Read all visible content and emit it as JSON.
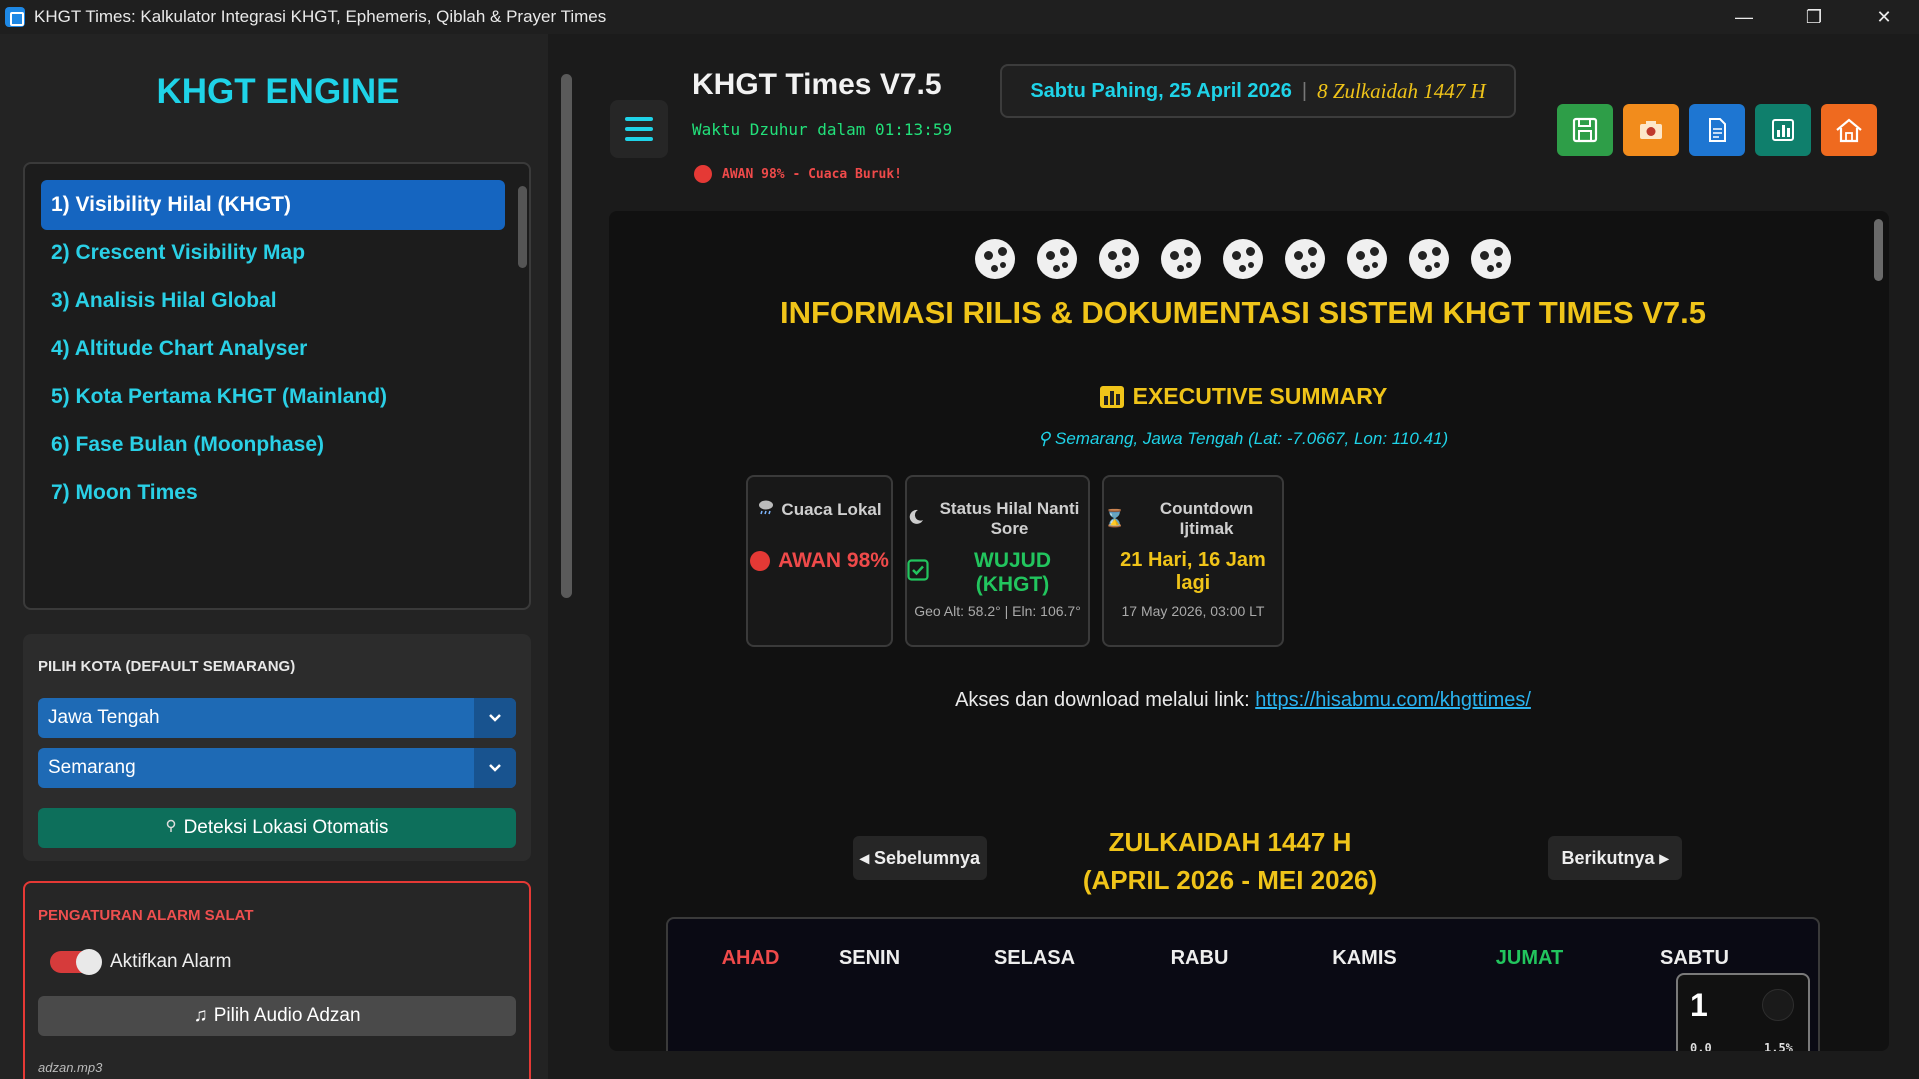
{
  "window": {
    "title": "KHGT Times: Kalkulator Integrasi KHGT, Ephemeris, Qiblah & Prayer Times",
    "minimize": "—",
    "maximize": "❐",
    "close": "✕"
  },
  "sidebar": {
    "engine_title": "KHGT ENGINE",
    "menu": [
      {
        "label": "1) Visibility Hilal (KHGT)",
        "active": true
      },
      {
        "label": "2) Crescent Visibility Map"
      },
      {
        "label": "3) Analisis Hilal Global"
      },
      {
        "label": "4) Altitude Chart Analyser"
      },
      {
        "label": "5) Kota Pertama KHGT (Mainland)"
      },
      {
        "label": "6) Fase Bulan (Moonphase)"
      },
      {
        "label": "7) Moon Times"
      }
    ],
    "city": {
      "label": "PILIH KOTA (DEFAULT SEMARANG)",
      "province": "Jawa Tengah",
      "city": "Semarang",
      "detect_button": "Deteksi Lokasi Otomatis"
    },
    "alarm": {
      "label": "PENGATURAN ALARM SALAT",
      "toggle_label": "Aktifkan Alarm",
      "toggle_on": true,
      "audio_button": "Pilih Audio Adzan",
      "audio_file": "adzan.mp3"
    }
  },
  "header": {
    "app_title": "KHGT Times V7.5",
    "dzuhur_countdown": "Waktu Dzuhur dalam 01:13:59",
    "weather_alert": "AWAN 98% - Cuaca Buruk!",
    "gregorian_date": "Sabtu Pahing, 25 April 2026",
    "separator": "|",
    "hijri_date": "8 Zulkaidah 1447 H",
    "tools": [
      {
        "icon": "save-icon",
        "color": "#2e9e48"
      },
      {
        "icon": "camera-icon",
        "color": "#f28c1c"
      },
      {
        "icon": "document-icon",
        "color": "#1e76d2"
      },
      {
        "icon": "chart-icon",
        "color": "#0f7f6c"
      },
      {
        "icon": "home-icon",
        "color": "#ef6a1f"
      }
    ]
  },
  "main": {
    "heading": "INFORMASI RILIS & DOKUMENTASI SISTEM KHGT TIMES V7.5",
    "exec_title": "EXECUTIVE SUMMARY",
    "location": "Semarang, Jawa Tengah (Lat: -7.0667, Lon: 110.41)",
    "cards": [
      {
        "title": "Cuaca Lokal",
        "value": "AWAN 98%",
        "sub": ""
      },
      {
        "title": "Status Hilal Nanti Sore",
        "value": "WUJUD (KHGT)",
        "sub": "Geo Alt: 58.2° | Eln: 106.7°"
      },
      {
        "title": "Countdown Ijtimak",
        "value": "21 Hari, 16 Jam lagi",
        "sub": "17 May 2026, 03:00 LT"
      }
    ],
    "link_prefix": "Akses dan download melalui link:",
    "link_url": "https://hisabmu.com/khgttimes/",
    "calendar": {
      "prev_button": "◂ Sebelumnya",
      "next_button": "Berikutnya ▸",
      "month_line1": "ZULKAIDAH 1447 H",
      "month_line2": "(APRIL 2026 - MEI 2026)",
      "days": [
        "AHAD",
        "SENIN",
        "SELASA",
        "RABU",
        "KAMIS",
        "JUMAT",
        "SABTU"
      ],
      "first_day": {
        "hijri": "1",
        "left_text": "0.0",
        "illumination": "1.5%"
      }
    }
  },
  "colors": {
    "accent_cyan": "#1fd3e8",
    "gold": "#f0c419",
    "alert_red": "#ef4a4a",
    "success_green": "#22c55e"
  }
}
